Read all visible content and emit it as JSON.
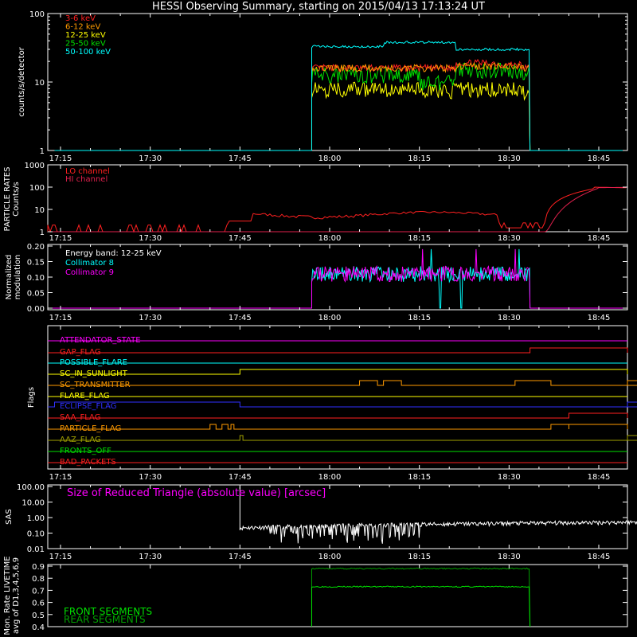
{
  "title": "HESSI Observing Summary, starting on 2015/04/13 17:13:24 UT",
  "colors": {
    "red": "#ff2020",
    "orange": "#ff9a00",
    "yellow": "#ffff00",
    "green": "#00e000",
    "cyan": "#00ffff",
    "magenta": "#ff00ff",
    "crimson": "#e0204c",
    "blue": "#3030ff",
    "olive": "#a0a000",
    "darkgreen": "#00a000",
    "white": "#ffffff"
  },
  "chart_data": [
    {
      "id": "count-rates",
      "type": "line",
      "ylabel": "counts/s/detector",
      "yscale": "log",
      "ylim": [
        1,
        100
      ],
      "yticks": [
        "1",
        "10",
        "100"
      ],
      "xticks": [
        "17:15",
        "17:30",
        "17:45",
        "18:00",
        "18:15",
        "18:30",
        "18:45"
      ],
      "xlim_minutes": [
        -16,
        84
      ],
      "series": [
        {
          "name": "3-6 keV",
          "color": "#ff2020",
          "segments": [
            [
              27,
              16
            ],
            [
              51,
              19
            ],
            [
              58,
              18
            ],
            [
              62,
              16
            ]
          ]
        },
        {
          "name": "6-12 keV",
          "color": "#ff9a00",
          "segments": [
            [
              27,
              16
            ],
            [
              51,
              17
            ],
            [
              62,
              16
            ]
          ]
        },
        {
          "name": "12-25 keV",
          "color": "#ffff00",
          "segments": [
            [
              27,
              8
            ],
            [
              45,
              7.5
            ],
            [
              51,
              8
            ],
            [
              62,
              7
            ]
          ]
        },
        {
          "name": "25-50 keV",
          "color": "#00e000",
          "segments": [
            [
              27,
              13
            ],
            [
              45,
              10
            ],
            [
              51,
              15
            ],
            [
              62,
              14
            ]
          ]
        },
        {
          "name": "50-100 keV",
          "color": "#00ffff",
          "segments": [
            [
              27,
              33
            ],
            [
              39,
              38
            ],
            [
              51,
              30
            ],
            [
              62,
              30
            ]
          ]
        }
      ],
      "on_interval": [
        27,
        63.5
      ]
    },
    {
      "id": "particle-rates",
      "type": "line",
      "ylabel": "PARTICLE RATES Counts/s",
      "yscale": "log",
      "ylim": [
        1,
        1000
      ],
      "yticks": [
        "1",
        "10",
        "100",
        "1000"
      ],
      "xticks": [
        "17:15",
        "17:30",
        "17:45",
        "18:00",
        "18:15",
        "18:30",
        "18:45"
      ],
      "series": [
        {
          "name": "LO channel",
          "color": "#ff2020"
        },
        {
          "name": "HI channel",
          "color": "#e0204c"
        }
      ]
    },
    {
      "id": "modulation",
      "type": "line",
      "ylabel": "Normalized modulation",
      "ylim": [
        0,
        0.2
      ],
      "yticks": [
        "0.00",
        "0.05",
        "0.10",
        "0.15",
        "0.20"
      ],
      "xticks": [
        "17:15",
        "17:30",
        "17:45",
        "18:00",
        "18:15",
        "18:30",
        "18:45"
      ],
      "annotation": "Energy band: 12-25 keV",
      "series": [
        {
          "name": "Collimator 8",
          "color": "#00ffff",
          "level": 0.11
        },
        {
          "name": "Collimator 9",
          "color": "#ff00ff",
          "level": 0.11
        }
      ]
    },
    {
      "id": "flags",
      "type": "line",
      "ylabel": "Flags",
      "xticks": [
        "17:15",
        "17:30",
        "17:45",
        "18:00",
        "18:15",
        "18:30",
        "18:45"
      ],
      "flags": [
        {
          "name": "ATTENDATOR_STATE",
          "color": "#ff00ff",
          "steps": []
        },
        {
          "name": "GAP_FLAG",
          "color": "#ff2020",
          "steps": [
            [
              63.5,
              84
            ]
          ]
        },
        {
          "name": "POSSIBLE_FLARE",
          "color": "#00ffff",
          "steps": []
        },
        {
          "name": "SC_IN_SUNLIGHT",
          "color": "#ffff00",
          "steps": [
            [
              15,
              99.5
            ]
          ]
        },
        {
          "name": "SC_TRANSMITTER",
          "color": "#ff9a00",
          "steps": [
            [
              35,
              38
            ],
            [
              39,
              42
            ],
            [
              61,
              67
            ],
            [
              86,
              92
            ]
          ]
        },
        {
          "name": "FLARE_FLAG",
          "color": "#ffff00",
          "steps": []
        },
        {
          "name": "ECLIPSE_FLAG",
          "color": "#3030ff",
          "steps": [
            [
              -16,
              15
            ],
            [
              99.5,
              84
            ]
          ]
        },
        {
          "name": "SAA_FLAG",
          "color": "#ff2020",
          "steps": [
            [
              70,
              105
            ]
          ]
        },
        {
          "name": "PARTICLE_FLAG",
          "color": "#ff9a00",
          "steps": [
            [
              10,
              11
            ],
            [
              12,
              13
            ],
            [
              13.5,
              14
            ],
            [
              67,
              70
            ],
            [
              70,
              104
            ]
          ]
        },
        {
          "name": "AAZ_FLAG",
          "color": "#a0a000",
          "steps": [
            [
              15,
              15.5
            ],
            [
              99.2,
              99.7
            ]
          ]
        },
        {
          "name": "FRONTS_OFF",
          "color": "#00e000",
          "steps": []
        },
        {
          "name": "BAD_PACKETS",
          "color": "#ff2020",
          "steps": []
        }
      ]
    },
    {
      "id": "sas",
      "type": "line",
      "ylabel": "SAS",
      "yscale": "log",
      "ylim": [
        0.01,
        100
      ],
      "yticks": [
        "0.01",
        "0.10",
        "1.00",
        "10.00",
        "100.00"
      ],
      "xticks": [
        "17:15",
        "17:30",
        "17:45",
        "18:00",
        "18:15",
        "18:30",
        "18:45"
      ],
      "annotation": "Size of Reduced Triangle (absolute value) [arcsec]",
      "series": [
        {
          "name": "",
          "color": "#ffffff"
        }
      ]
    },
    {
      "id": "livetime",
      "type": "line",
      "ylabel": "Mon. Rate LIVETIME avg of D1,3,4,5,6,9",
      "ylim": [
        0.4,
        0.9
      ],
      "yticks": [
        "0.4",
        "0.5",
        "0.6",
        "0.7",
        "0.8",
        "0.9"
      ],
      "xticks": [],
      "series": [
        {
          "name": "FRONT SEGMENTS",
          "color": "#00e000",
          "level": 0.73
        },
        {
          "name": "REAR SEGMENTS",
          "color": "#00a000",
          "level": 0.88
        }
      ],
      "on_interval": [
        27,
        63.5
      ]
    }
  ]
}
